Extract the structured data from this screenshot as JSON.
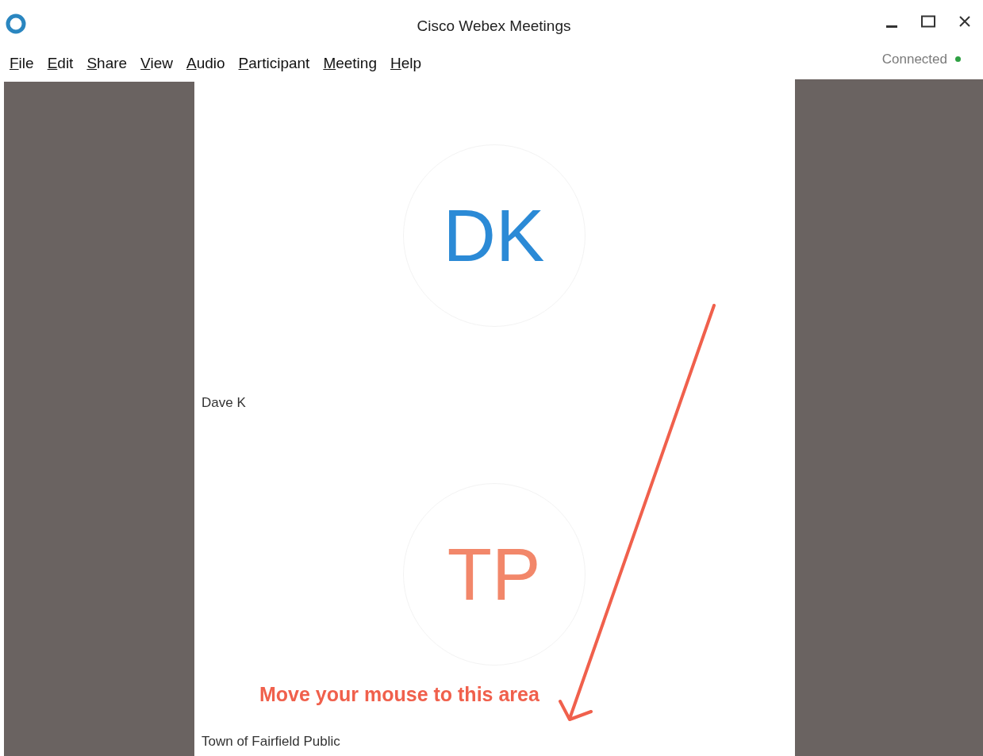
{
  "window": {
    "title": "Cisco Webex Meetings"
  },
  "menu": [
    "File",
    "Edit",
    "Share",
    "View",
    "Audio",
    "Participant",
    "Meeting",
    "Help"
  ],
  "status": {
    "label": "Connected",
    "color": "#2ea043"
  },
  "participants": [
    {
      "initials": "DK",
      "name": "Dave K",
      "color": "#2b8ad6"
    },
    {
      "initials": "TP",
      "name": "Town of Fairfield Public",
      "color": "#f2876a"
    }
  ],
  "annotation": {
    "text": "Move your mouse to this area",
    "color": "#f0604c"
  }
}
